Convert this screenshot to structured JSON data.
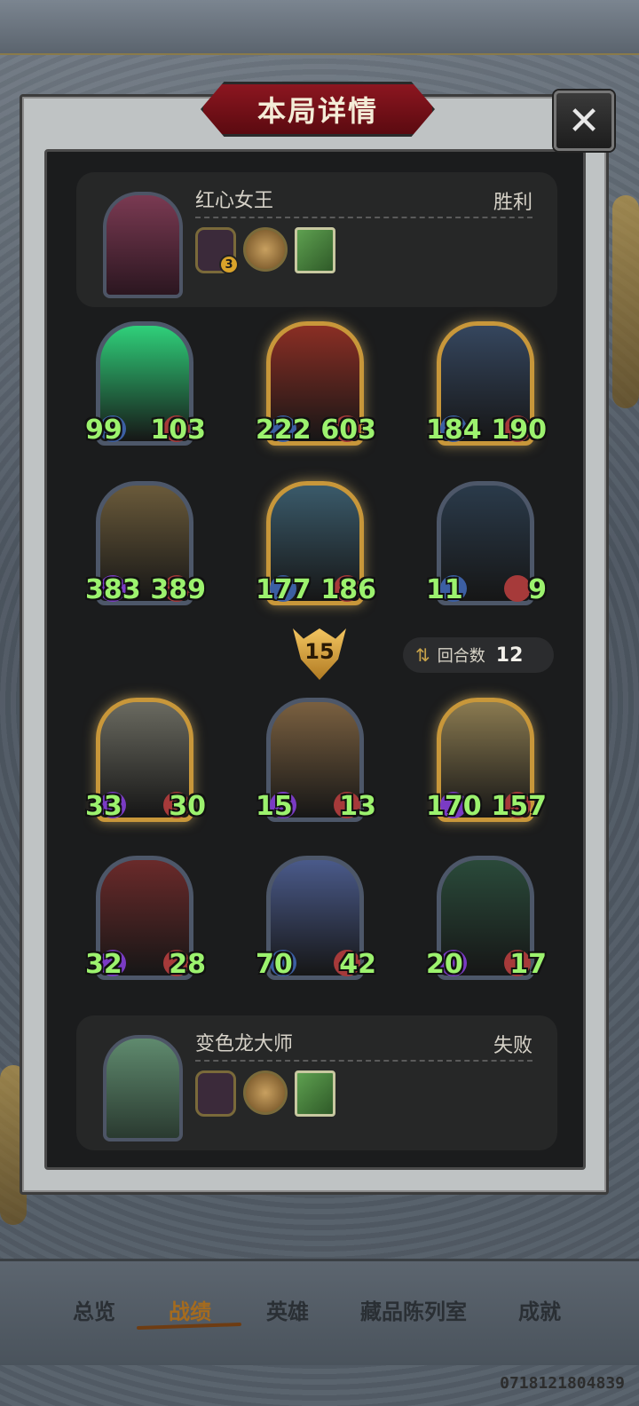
{
  "dialog": {
    "title": "本局详情",
    "close_label": "✕"
  },
  "top_player": {
    "name": "红心女王",
    "result": "胜利",
    "items": [
      {
        "icon": "hero-token-icon",
        "badge": "3"
      },
      {
        "icon": "coin-icon"
      },
      {
        "icon": "spellbook-icon"
      }
    ]
  },
  "top_units": [
    {
      "atk": "99",
      "hp": "103",
      "frame": "silver",
      "atk_type": "blue",
      "color": "#2fd07a"
    },
    {
      "atk": "222",
      "hp": "603",
      "frame": "gold",
      "atk_type": "blue",
      "color": "#8a2e24"
    },
    {
      "atk": "184",
      "hp": "190",
      "frame": "gold",
      "atk_type": "blue",
      "color": "#35465e"
    },
    {
      "atk": "383",
      "hp": "389",
      "frame": "silver",
      "atk_type": "purple",
      "color": "#6a5a3a"
    },
    {
      "atk": "177",
      "hp": "186",
      "frame": "gold",
      "atk_type": "blue",
      "color": "#3a5a6a"
    },
    {
      "atk": "11",
      "hp": "9",
      "frame": "silver",
      "atk_type": "blue",
      "color": "#2a3a4a"
    }
  ],
  "tavern_level": "15",
  "round": {
    "label": "回合数",
    "value": "12"
  },
  "bottom_units": [
    {
      "atk": "33",
      "hp": "30",
      "frame": "gold",
      "atk_type": "purple",
      "color": "#6a6a60"
    },
    {
      "atk": "15",
      "hp": "13",
      "frame": "silver",
      "atk_type": "purple",
      "color": "#7a6040"
    },
    {
      "atk": "170",
      "hp": "157",
      "frame": "gold",
      "atk_type": "purple",
      "color": "#8a7a50"
    },
    {
      "atk": "32",
      "hp": "28",
      "frame": "silver",
      "atk_type": "purple",
      "color": "#6a2a2a"
    },
    {
      "atk": "70",
      "hp": "42",
      "frame": "silver",
      "atk_type": "blue",
      "color": "#4a5a8a"
    },
    {
      "atk": "20",
      "hp": "17",
      "frame": "silver",
      "atk_type": "purple",
      "color": "#2a4a3a"
    }
  ],
  "bottom_player": {
    "name": "变色龙大师",
    "result": "失败",
    "items": [
      {
        "icon": "hero-token-icon"
      },
      {
        "icon": "coin-icon"
      },
      {
        "icon": "spellbook-icon"
      }
    ]
  },
  "nav": {
    "overview": "总览",
    "records": "战绩",
    "heroes": "英雄",
    "collection": "藏品陈列室",
    "achievements": "成就"
  },
  "footer_id": "0718121804839"
}
